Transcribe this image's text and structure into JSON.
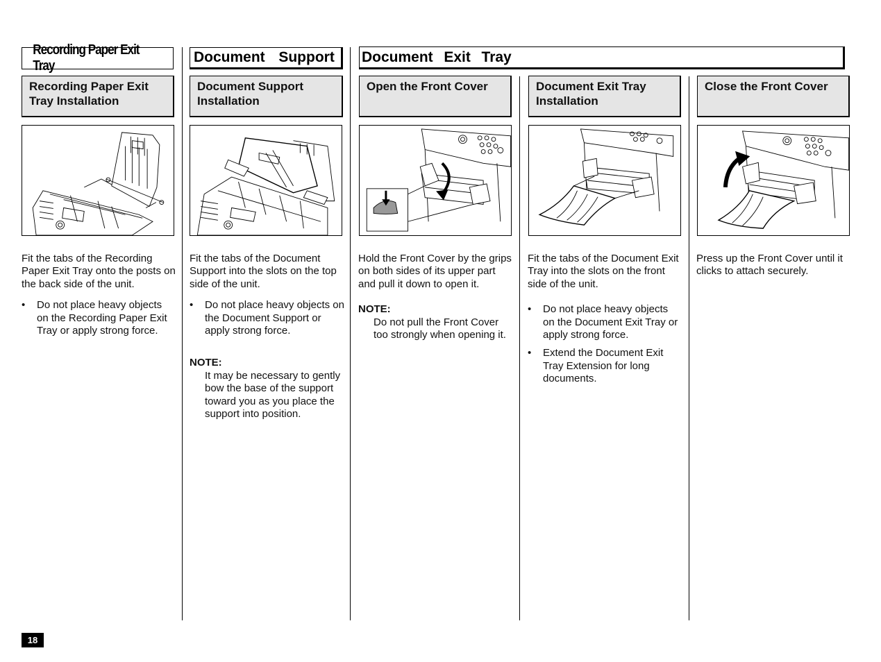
{
  "sections": {
    "recording_tray": {
      "title": "Recording Paper Exit Tray",
      "step_title": "Recording Paper Exit Tray Installation",
      "figure": "recording-paper-exit-tray-illustration",
      "paragraph": "Fit the tabs of the Recording Paper Exit Tray onto the posts on the back side of the unit.",
      "bullets": [
        "Do not place heavy objects on the Recording Paper Exit Tray or apply strong force."
      ]
    },
    "document_support": {
      "title": "Document  Support",
      "step_title": "Document Support Installation",
      "figure": "document-support-illustration",
      "paragraph": "Fit the tabs of the Document Support into the slots on the top side of the unit.",
      "bullets": [
        "Do not place heavy objects on the Document Support or apply strong force."
      ],
      "note_label": "NOTE:",
      "note": "It may be necessary to gently bow the base of the support toward you as you place the support into position."
    },
    "document_exit_tray": {
      "title": "Document  Exit  Tray",
      "steps": [
        {
          "step_title": "Open the Front Cover",
          "figure": "open-front-cover-illustration",
          "paragraph": "Hold the Front Cover by the grips on both sides of its upper part and pull it down to open it.",
          "note_label": "NOTE:",
          "note": "Do not pull the Front Cover too strongly when opening it."
        },
        {
          "step_title": "Document Exit Tray Installation",
          "figure": "document-exit-tray-illustration",
          "paragraph": "Fit the tabs of the Document Exit Tray into the slots on the front side of the unit.",
          "bullets": [
            "Do not place heavy objects on the Document Exit Tray or apply strong force.",
            "Extend the Document Exit Tray Extension for long documents."
          ]
        },
        {
          "step_title": "Close the Front Cover",
          "figure": "close-front-cover-illustration",
          "paragraph": "Press up the Front Cover until it clicks to attach securely."
        }
      ]
    }
  },
  "bullet_glyph": "•",
  "page_number": "18",
  "colors": {
    "step_box_fill": "#e5e5e5",
    "ink": "#000000"
  }
}
